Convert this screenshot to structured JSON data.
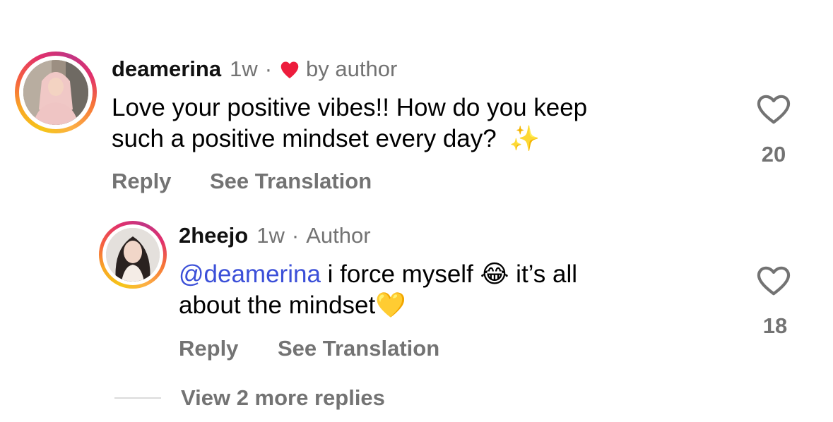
{
  "comments": [
    {
      "username": "deamerina",
      "time": "1w",
      "separator": "·",
      "liked_by_author_label": "by author",
      "text": "Love your positive vibes!! How do you keep such a positive mindset every day? ✨",
      "text_line1": "Love your positive vibes!! How do you keep",
      "text_line2": "such a positive mindset every day?",
      "emoji": "✨",
      "reply_label": "Reply",
      "translate_label": "See Translation",
      "like_count": "20"
    },
    {
      "username": "2heejo",
      "time": "1w",
      "separator": "·",
      "author_badge": "Author",
      "mention": "@deamerina",
      "text_part1": " i force myself ",
      "emoji1": "😂",
      "text_part2": " it’s all",
      "text_line2": "about the mindset",
      "emoji2": "💛",
      "reply_label": "Reply",
      "translate_label": "See Translation",
      "like_count": "18"
    }
  ],
  "view_more_replies": "View 2 more replies",
  "colors": {
    "like_red": "#ed1c3c",
    "meta_gray": "#737373",
    "mention_blue": "#3b4fd8"
  }
}
